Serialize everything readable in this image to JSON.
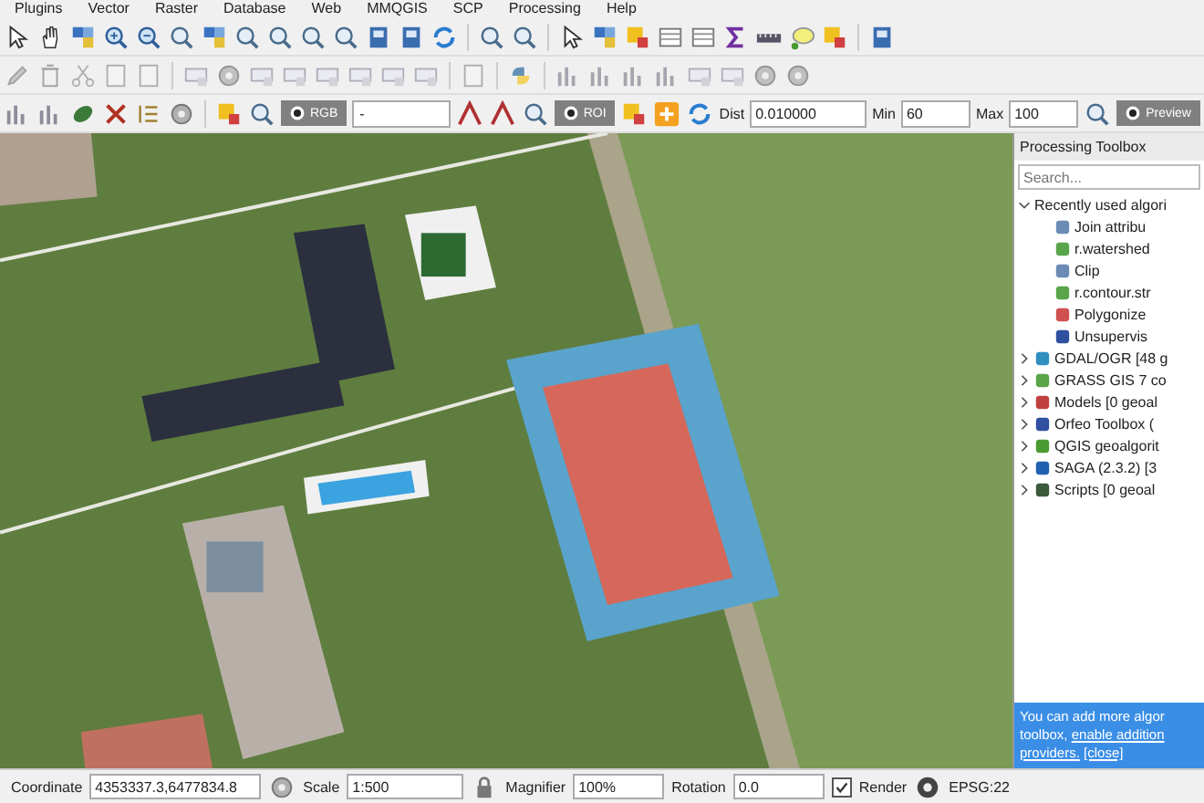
{
  "menu": [
    "Plugins",
    "Vector",
    "Raster",
    "Database",
    "Web",
    "MMQGIS",
    "SCP",
    "Processing",
    "Help"
  ],
  "scp_toolbar": {
    "rgb": {
      "label": "RGB",
      "on": true
    },
    "band_set": {
      "value": "-"
    },
    "roi": {
      "label": "ROI",
      "on": true
    },
    "dist": {
      "label": "Dist",
      "value": "0.010000"
    },
    "min": {
      "label": "Min",
      "value": "60"
    },
    "max": {
      "label": "Max",
      "value": "100"
    },
    "preview": {
      "label": "Preview",
      "on": true
    }
  },
  "toolbox": {
    "title": "Processing Toolbox",
    "search": {
      "placeholder": "Search..."
    },
    "tree": [
      {
        "label": "Recently used algori",
        "expanded": true,
        "children": [
          {
            "label": "Join attribu",
            "kind": "vector"
          },
          {
            "label": "r.watershed",
            "kind": "grass"
          },
          {
            "label": "Clip",
            "kind": "vector"
          },
          {
            "label": "r.contour.str",
            "kind": "grass"
          },
          {
            "label": "Polygonize",
            "kind": "polygon"
          },
          {
            "label": "Unsupervis",
            "kind": "orfeo"
          }
        ]
      },
      {
        "label": "GDAL/OGR [48 g",
        "expanded": false,
        "kind": "gdal"
      },
      {
        "label": "GRASS GIS 7 co",
        "expanded": false,
        "kind": "grass"
      },
      {
        "label": "Models [0 geoal",
        "expanded": false,
        "kind": "models"
      },
      {
        "label": "Orfeo Toolbox (",
        "expanded": false,
        "kind": "orfeo"
      },
      {
        "label": "QGIS geoalgorit",
        "expanded": false,
        "kind": "qgis"
      },
      {
        "label": "SAGA (2.3.2) [3",
        "expanded": false,
        "kind": "saga"
      },
      {
        "label": "Scripts [0 geoal",
        "expanded": false,
        "kind": "scripts"
      }
    ],
    "notice": {
      "line_1": "You can add more algor",
      "line_2": "toolbox,",
      "link_1": "enable addition",
      "link_2": "providers.",
      "link_3": "[close]"
    }
  },
  "status_bar": {
    "coordinate": {
      "label": "Coordinate",
      "value": "4353337.3,6477834.8"
    },
    "scale": {
      "label": "Scale",
      "value": "1:500"
    },
    "magnifier": {
      "label": "Magnifier",
      "value": "100%"
    },
    "rotation": {
      "label": "Rotation",
      "value": "0.0"
    },
    "render": {
      "label": "Render",
      "checked": true
    },
    "crs": "EPSG:22"
  }
}
